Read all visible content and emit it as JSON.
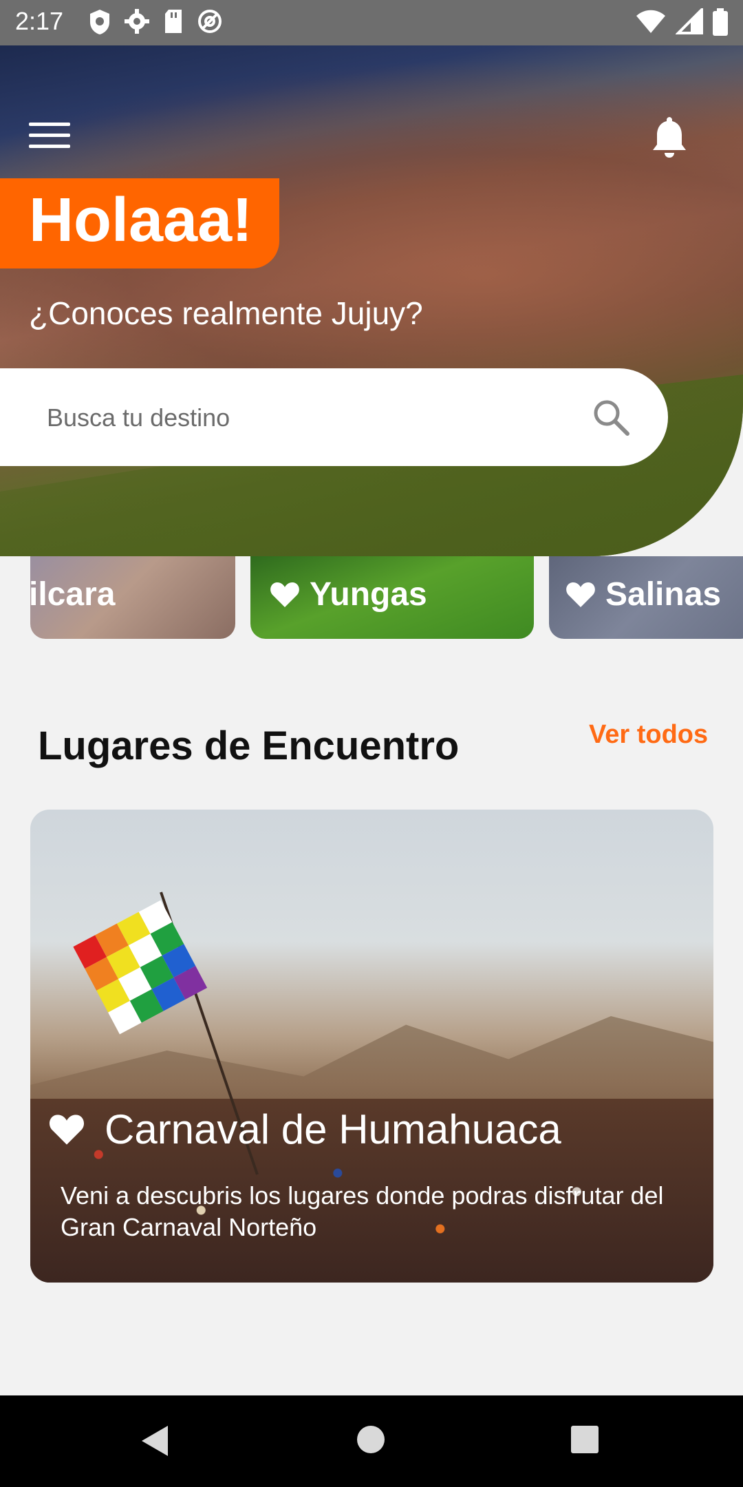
{
  "status_bar": {
    "time": "2:17",
    "left_icons": [
      "shield-icon",
      "gear-icon",
      "sd-card-icon",
      "at-sign-icon"
    ],
    "right_icons": [
      "wifi-icon",
      "signal-icon",
      "battery-icon"
    ]
  },
  "header": {
    "greeting": "Holaaa!",
    "subtitle": "¿Conoces realmente Jujuy?",
    "accent_color": "#ff6500"
  },
  "search": {
    "placeholder": "Busca tu destino"
  },
  "categories": [
    {
      "label": "ilcara"
    },
    {
      "label": "Yungas"
    },
    {
      "label": "Salinas"
    }
  ],
  "section": {
    "title": "Lugares de Encuentro",
    "see_all": "Ver todos",
    "see_all_color": "#ff6a14"
  },
  "feature": {
    "title": "Carnaval de Humahuaca",
    "description": "Veni a descubris los lugares donde podras disfrutar del Gran Carnaval Norteño"
  },
  "nav_bar": {
    "icons": [
      "back-icon",
      "home-icon",
      "recents-icon"
    ]
  }
}
